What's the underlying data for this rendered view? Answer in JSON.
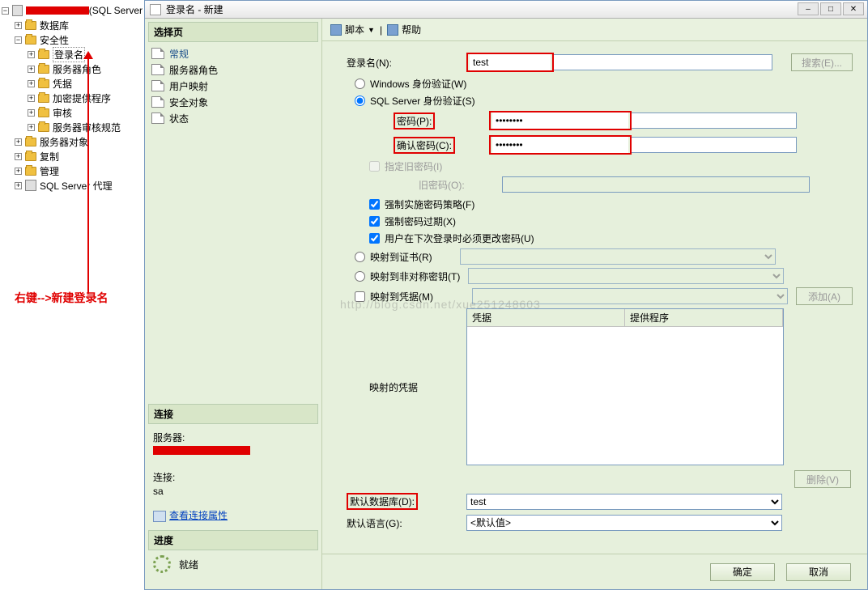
{
  "tree": {
    "root_suffix": "(SQL Server",
    "items": {
      "db": "数据库",
      "security": "安全性",
      "logins": "登录名",
      "server_roles": "服务器角色",
      "credentials": "凭据",
      "crypto": "加密提供程序",
      "audit": "审核",
      "audit_spec": "服务器审核规范",
      "server_objects": "服务器对象",
      "replication": "复制",
      "management": "管理",
      "agent": "SQL Server 代理"
    }
  },
  "annotation": "右键-->新建登录名",
  "dialog": {
    "title": "登录名 - 新建",
    "toolbar": {
      "script": "脚本",
      "help": "帮助"
    },
    "pages_header": "选择页",
    "pages": {
      "general": "常规",
      "server_roles": "服务器角色",
      "user_map": "用户映射",
      "securables": "安全对象",
      "status": "状态"
    },
    "conn_header": "连接",
    "conn": {
      "server_label": "服务器:",
      "conn_label": "连接:",
      "conn_value": "sa",
      "view_props": "查看连接属性"
    },
    "prog_header": "进度",
    "prog_status": "就绪",
    "form": {
      "login_label": "登录名(N):",
      "login_value": "test",
      "search_btn": "搜索(E)...",
      "auth_win": "Windows 身份验证(W)",
      "auth_sql": "SQL Server 身份验证(S)",
      "pwd_label": "密码(P):",
      "pwd_value": "●●●●●●●●",
      "cpwd_label": "确认密码(C):",
      "cpwd_value": "●●●●●●●●",
      "oldpwd_chk": "指定旧密码(I)",
      "oldpwd_label": "旧密码(O):",
      "enforce_policy": "强制实施密码策略(F)",
      "enforce_expire": "强制密码过期(X)",
      "must_change": "用户在下次登录时必须更改密码(U)",
      "map_cert": "映射到证书(R)",
      "map_asym": "映射到非对称密钥(T)",
      "map_cred": "映射到凭据(M)",
      "add_btn": "添加(A)",
      "cred_table_label": "映射的凭据",
      "cred_col1": "凭据",
      "cred_col2": "提供程序",
      "remove_btn": "删除(V)",
      "default_db_label": "默认数据库(D):",
      "default_db_value": "test",
      "default_lang_label": "默认语言(G):",
      "default_lang_value": "<默认值>"
    },
    "ok": "确定",
    "cancel": "取消"
  },
  "watermark": "http://blog.csdn.net/xue251248603"
}
